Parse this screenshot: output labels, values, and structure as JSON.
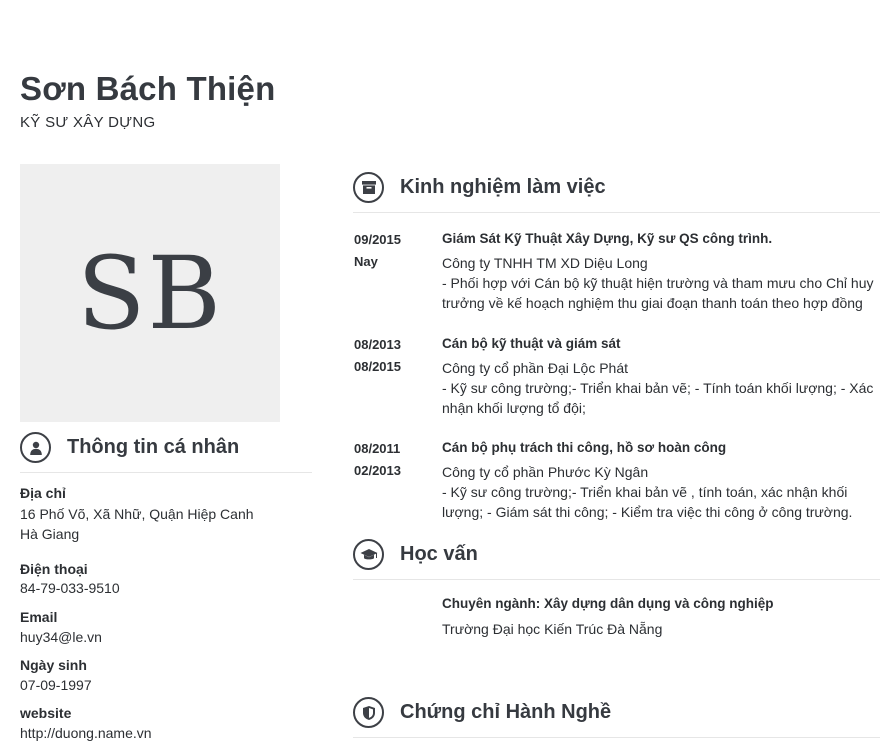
{
  "profile": {
    "name": "Sơn Bách Thiện",
    "title": "KỸ SƯ XÂY DỰNG",
    "initials": "SB"
  },
  "personal": {
    "heading": "Thông tin cá nhân",
    "icon": "user-icon",
    "address_label": "Địa chỉ",
    "address_line1": "16 Phố Võ, Xã Nhữ, Quận Hiệp Canh",
    "address_line2": "Hà Giang",
    "phone_label": "Điện thoại",
    "phone": "84-79-033-9510",
    "email_label": "Email",
    "email": "huy34@le.vn",
    "birthday_label": "Ngày sinh",
    "birthday": "07-09-1997",
    "website_label": "website",
    "website": "http://duong.name.vn"
  },
  "experience": {
    "heading": "Kinh nghiệm làm việc",
    "icon": "archive-box-icon",
    "items": [
      {
        "start": "09/2015",
        "end": "Nay",
        "role": "Giám Sát Kỹ Thuật Xây Dựng, Kỹ sư QS công trình.",
        "company": "Công ty TNHH TM XD Diệu Long",
        "desc": "- Phối hợp với Cán bộ kỹ thuật hiện trường và tham mưu cho Chỉ huy trưởng về kế hoạch nghiệm thu giai đoạn thanh toán theo hợp đồng"
      },
      {
        "start": "08/2013",
        "end": "08/2015",
        "role": "Cán bộ kỹ thuật và giám sát",
        "company": "Công ty cổ phần Đại Lộc Phát",
        "desc": "- Kỹ sư công trường;- Triển khai bản vẽ;  - Tính toán khối lượng; - Xác nhận khối lượng tổ đội;"
      },
      {
        "start": "08/2011",
        "end": "02/2013",
        "role": "Cán bộ phụ trách thi công, hồ sơ hoàn công",
        "company": "Công ty cổ phần Phước Kỳ Ngân",
        "desc": "- Kỹ sư công trường;- Triển khai bản vẽ , tính toán, xác nhận khối lượng; - Giám sát thi công; - Kiểm tra việc thi công ở công trường."
      }
    ]
  },
  "education": {
    "heading": "Học vấn",
    "icon": "graduation-cap-icon",
    "major": "Chuyên ngành: Xây dựng dân dụng và công nghiệp",
    "school": "Trường Đại học Kiến Trúc Đà Nẵng"
  },
  "certificates": {
    "heading": "Chứng chỉ Hành Nghề",
    "icon": "shield-icon"
  }
}
